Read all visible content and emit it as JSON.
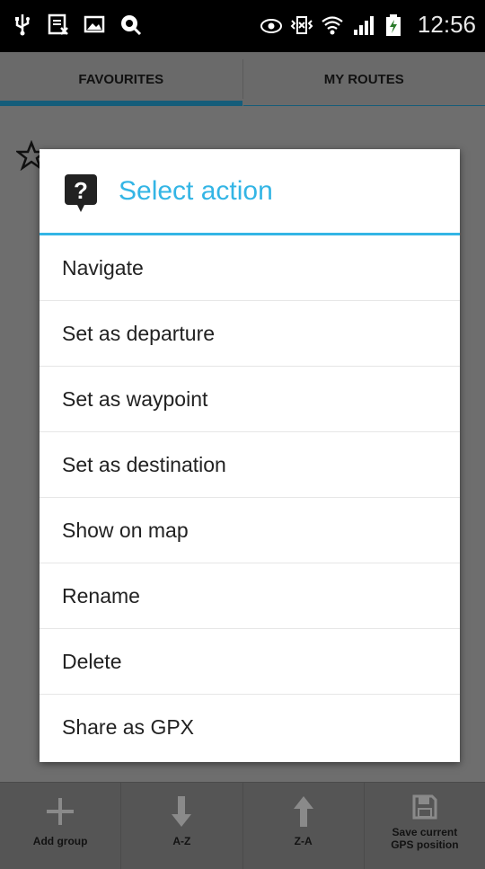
{
  "status_bar": {
    "time": "12:56",
    "left_icons": [
      "usb-icon",
      "notification-icon",
      "image-icon",
      "app-icon"
    ],
    "right_icons": [
      "eye-icon",
      "vibrate-icon",
      "wifi-icon",
      "signal-icon",
      "battery-icon"
    ]
  },
  "tabs": [
    {
      "label": "FAVOURITES",
      "active": true
    },
    {
      "label": "MY ROUTES",
      "active": false
    }
  ],
  "dialog": {
    "title": "Select action",
    "icon": "question-icon",
    "accent": "#33b5e5",
    "items": [
      "Navigate",
      "Set as departure",
      "Set as waypoint",
      "Set as destination",
      "Show on map",
      "Rename",
      "Delete",
      "Share as GPX"
    ]
  },
  "toolbar": {
    "buttons": [
      {
        "label": "Add group",
        "icon": "plus-icon"
      },
      {
        "label": "A-Z",
        "icon": "arrow-down-icon"
      },
      {
        "label": "Z-A",
        "icon": "arrow-up-icon"
      },
      {
        "label": "Save current\nGPS position",
        "icon": "save-icon"
      }
    ]
  }
}
